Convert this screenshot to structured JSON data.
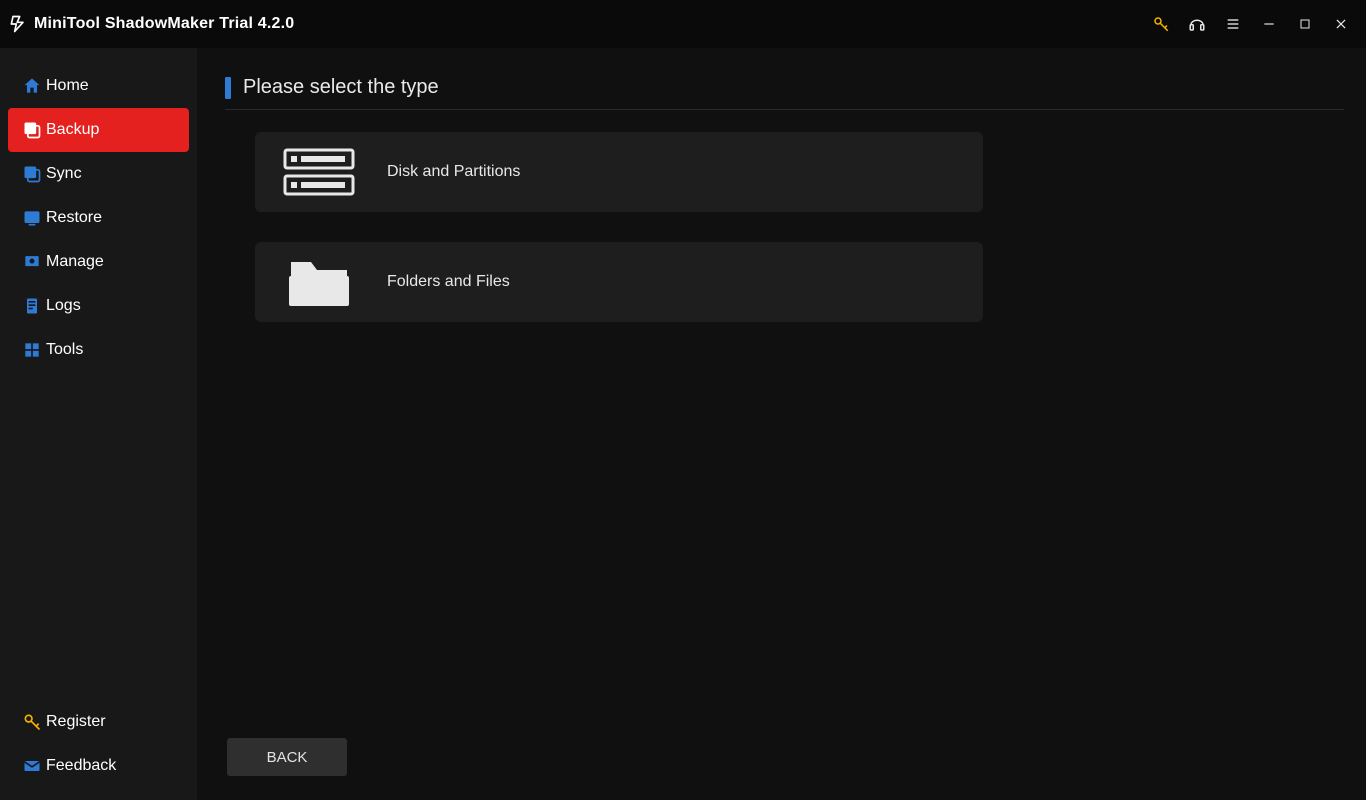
{
  "titlebar": {
    "title": "MiniTool ShadowMaker Trial 4.2.0"
  },
  "sidebar": {
    "items": [
      {
        "label": "Home"
      },
      {
        "label": "Backup"
      },
      {
        "label": "Sync"
      },
      {
        "label": "Restore"
      },
      {
        "label": "Manage"
      },
      {
        "label": "Logs"
      },
      {
        "label": "Tools"
      }
    ],
    "bottom": {
      "register": "Register",
      "feedback": "Feedback"
    }
  },
  "main": {
    "heading": "Please select the type",
    "option_disk": "Disk and Partitions",
    "option_folders": "Folders and Files",
    "back_label": "BACK"
  }
}
